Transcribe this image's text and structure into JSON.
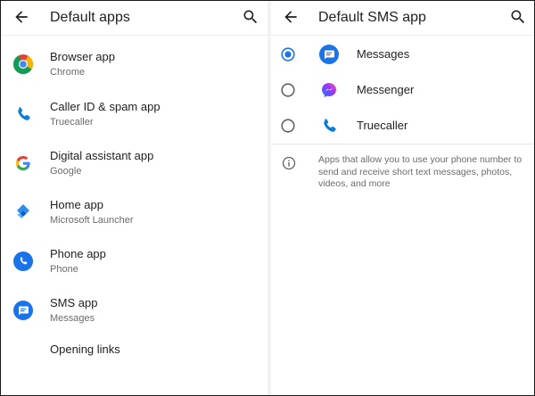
{
  "left": {
    "title": "Default apps",
    "items": [
      {
        "label": "Browser app",
        "value": "Chrome"
      },
      {
        "label": "Caller ID & spam app",
        "value": "Truecaller"
      },
      {
        "label": "Digital assistant app",
        "value": "Google"
      },
      {
        "label": "Home app",
        "value": "Microsoft Launcher"
      },
      {
        "label": "Phone app",
        "value": "Phone"
      },
      {
        "label": "SMS app",
        "value": "Messages"
      },
      {
        "label": "Opening links"
      }
    ]
  },
  "right": {
    "title": "Default SMS app",
    "options": [
      {
        "label": "Messages",
        "selected": true
      },
      {
        "label": "Messenger",
        "selected": false
      },
      {
        "label": "Truecaller",
        "selected": false
      }
    ],
    "info": "Apps that allow you to use your phone number to send and receive short text messages, photos, videos, and more"
  },
  "icons": {
    "back": "arrow-back-icon",
    "search": "search-icon",
    "info": "info-icon",
    "apps": [
      "chrome-icon",
      "truecaller-phone-icon",
      "google-g-icon",
      "microsoft-launcher-icon",
      "phone-icon",
      "messages-icon"
    ]
  },
  "colors": {
    "accent": "#1a73e8",
    "messages_blue": "#1a73e8",
    "messenger": "#a033ff"
  }
}
